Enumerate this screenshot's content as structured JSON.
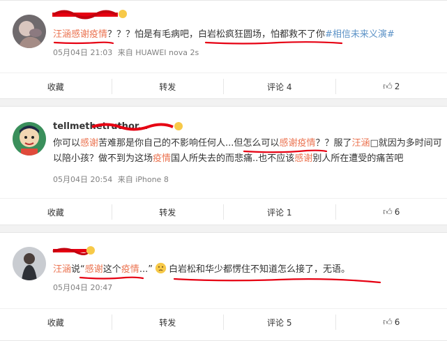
{
  "posts": [
    {
      "post_parts": [
        {
          "t": "汪涵感谢疫情",
          "c": "hl"
        },
        {
          "t": "？？？怕是有毛病吧，白岩松疯狂圆场，怕都救不了你",
          "c": ""
        },
        {
          "t": "#相信未来义演#",
          "c": "tag"
        }
      ],
      "date": "05月04日 21:03",
      "source": "来自 HUAWEI nova 2s",
      "actions": {
        "collect": "收藏",
        "repost": "转发",
        "comment": "评论 4",
        "like": "2"
      }
    },
    {
      "username": "tellmethetruthor...",
      "post_parts": [
        {
          "t": "你可以",
          "c": ""
        },
        {
          "t": "感谢",
          "c": "hl"
        },
        {
          "t": "苦难那是你自己的不影响任何人...但怎么可以",
          "c": ""
        },
        {
          "t": "感谢疫情",
          "c": "hl"
        },
        {
          "t": "？？服了",
          "c": ""
        },
        {
          "t": "汪涵",
          "c": "hl"
        },
        {
          "t": "□就因为多时间可以陪小孩？做不到为这场",
          "c": ""
        },
        {
          "t": "疫情",
          "c": "hl"
        },
        {
          "t": "国人所失去的而悲痛..也不应该",
          "c": ""
        },
        {
          "t": "感谢",
          "c": "hl"
        },
        {
          "t": "别人所在遭受的痛苦吧",
          "c": ""
        }
      ],
      "date": "05月04日 20:54",
      "source": "来自 iPhone 8",
      "actions": {
        "collect": "收藏",
        "repost": "转发",
        "comment": "评论 1",
        "like": "6"
      }
    },
    {
      "post_parts": [
        {
          "t": "汪涵",
          "c": "hl"
        },
        {
          "t": "说“",
          "c": ""
        },
        {
          "t": "感谢",
          "c": "hl"
        },
        {
          "t": "这个",
          "c": ""
        },
        {
          "t": "疫情",
          "c": "hl"
        },
        {
          "t": "...”",
          "c": ""
        },
        {
          "t": "[emoji]",
          "c": "emoji"
        },
        {
          "t": "白岩松和华少都愣住不知道怎么接了，无语。",
          "c": ""
        }
      ],
      "date": "05月04日 20:47",
      "source": "",
      "actions": {
        "collect": "收藏",
        "repost": "转发",
        "comment": "评论 5",
        "like": "6"
      }
    }
  ],
  "icons": {
    "like": "thumbs-up-icon",
    "inline_emoji": "thinking-face-emoji-icon"
  },
  "colors": {
    "highlight": "#eb7350",
    "hashtag": "#5d93c7",
    "annotation": "#e60012",
    "background": "#f2f2f2"
  }
}
